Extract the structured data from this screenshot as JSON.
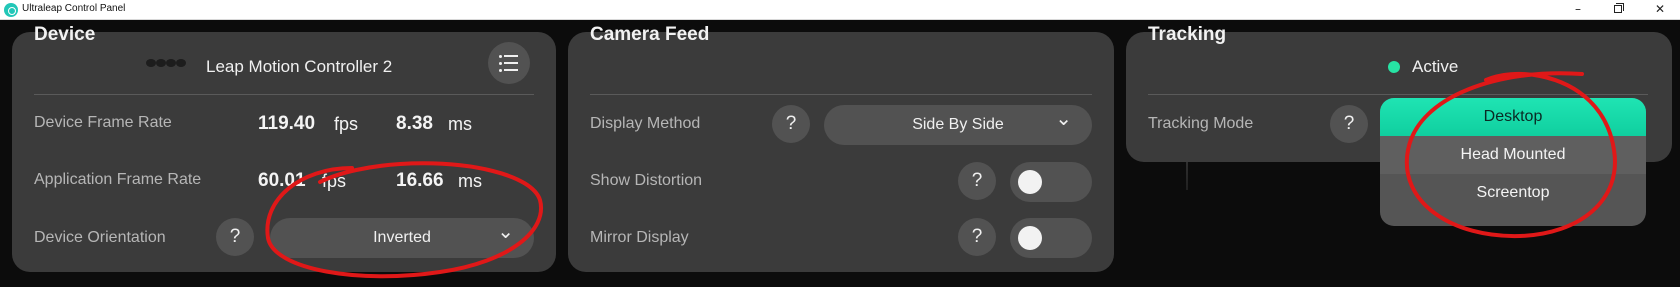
{
  "window": {
    "title": "Ultraleap Control Panel",
    "buttons": {
      "minimize": "–",
      "close": "✕"
    }
  },
  "device": {
    "title": "Device",
    "name": "Leap Motion Controller 2",
    "rows": {
      "device_frame_rate": {
        "label": "Device Frame Rate",
        "fps_value": "119.40",
        "fps_unit": "fps",
        "ms_value": "8.38",
        "ms_unit": "ms"
      },
      "application_frame_rate": {
        "label": "Application Frame Rate",
        "fps_value": "60.01",
        "fps_unit": "fps",
        "ms_value": "16.66",
        "ms_unit": "ms"
      },
      "device_orientation": {
        "label": "Device Orientation",
        "help": "?",
        "value": "Inverted",
        "chevron": "⌄"
      }
    }
  },
  "camera": {
    "title": "Camera Feed",
    "rows": {
      "display_method": {
        "label": "Display Method",
        "help": "?",
        "value": "Side By Side",
        "chevron": "⌄"
      },
      "show_distortion": {
        "label": "Show Distortion",
        "help": "?",
        "on": false
      },
      "mirror_display": {
        "label": "Mirror Display",
        "help": "?",
        "on": false
      }
    }
  },
  "tracking": {
    "title": "Tracking",
    "status": "Active",
    "status_color": "#27e3a4",
    "mode_label": "Tracking Mode",
    "help": "?",
    "options": [
      "Desktop",
      "Head Mounted",
      "Screentop"
    ],
    "selected": "Desktop"
  },
  "colors": {
    "panel": "#3b3b3b",
    "control": "#525252",
    "accent": "#1fe4b3",
    "annotation": "#e01818"
  }
}
